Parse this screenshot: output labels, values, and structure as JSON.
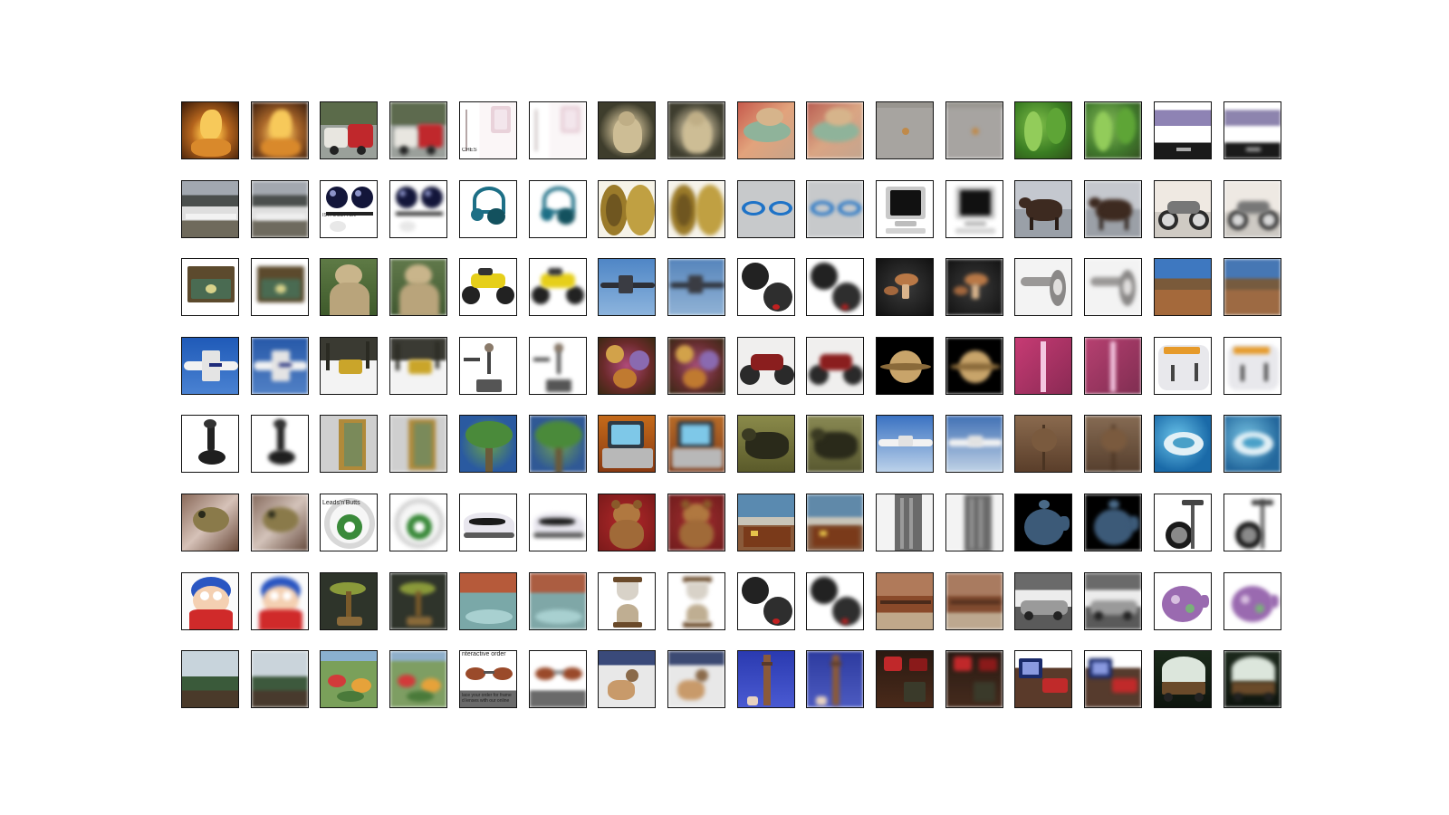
{
  "grid": {
    "rows": 8,
    "cols": 16,
    "pairing": "original image followed by its reconstruction"
  },
  "captions": {
    "r0c4": "CHES",
    "r1c2": "IS IT'S BUTTON",
    "r5c2": "Leads'n'Butts",
    "r7c4_top": "nteractive order",
    "r7c4_bottom": "lace your order for frame\nd lenses with our online"
  },
  "subjects": [
    [
      "golden-buddha",
      "golden-buddha",
      "red-car-vehicle",
      "red-car-vehicle",
      "ruler-chart",
      "ruler-chart",
      "leopard",
      "leopard",
      "plant-sketch",
      "plant-sketch",
      "grey-shirt",
      "grey-shirt",
      "green-fern",
      "green-fern",
      "purple-band",
      "purple-band"
    ],
    [
      "airport-runway",
      "airport-runway",
      "black-spheres-ad",
      "black-spheres-ad",
      "blue-headphones",
      "blue-headphones",
      "gold-coins",
      "gold-coins",
      "blue-glasses",
      "blue-glasses",
      "crt-monitor",
      "crt-monitor",
      "bull",
      "bull",
      "motorcycle",
      "motorcycle"
    ],
    [
      "open-case",
      "open-case",
      "stone-buddha",
      "stone-buddha",
      "yellow-dirtbike",
      "yellow-dirtbike",
      "jet-in-sky",
      "jet-in-sky",
      "baseball-gloves",
      "baseball-gloves",
      "mushrooms",
      "mushrooms",
      "door-handle",
      "door-handle",
      "desert-field",
      "desert-field"
    ],
    [
      "airliner",
      "airliner",
      "bulldozer-snow",
      "bulldozer-snow",
      "metronome",
      "metronome",
      "flower-bouquet",
      "flower-bouquet",
      "red-motorcycle",
      "red-motorcycle",
      "saturn",
      "saturn",
      "lightning",
      "lightning",
      "toaster",
      "toaster"
    ],
    [
      "joystick",
      "joystick",
      "gold-frame",
      "gold-frame",
      "palm-tree",
      "palm-tree",
      "laptop",
      "laptop",
      "triceratops",
      "triceratops",
      "airliner-sky",
      "airliner-sky",
      "bare-tree",
      "bare-tree",
      "sea-turtle",
      "sea-turtle"
    ],
    [
      "frog",
      "frog",
      "soccer-badge",
      "soccer-badge",
      "sneaker",
      "sneaker",
      "teddy-bear",
      "teddy-bear",
      "building",
      "building",
      "tall-tower",
      "tall-tower",
      "teapot",
      "teapot",
      "camera-tripod",
      "camera-tripod"
    ],
    [
      "cartoon-character",
      "cartoon-character",
      "bonsai",
      "bonsai",
      "hot-spring",
      "hot-spring",
      "hourglass",
      "hourglass",
      "baseball-gloves",
      "baseball-gloves",
      "stadium-seats",
      "stadium-seats",
      "car",
      "car",
      "floral-teapot",
      "floral-teapot"
    ],
    [
      "stadium",
      "stadium",
      "garden",
      "garden",
      "sunglasses-ad",
      "sunglasses-ad",
      "beach-statue",
      "beach-statue",
      "minaret",
      "minaret",
      "dark-interior",
      "dark-interior",
      "tv-room",
      "tv-room",
      "covered-wagon",
      "covered-wagon"
    ]
  ]
}
